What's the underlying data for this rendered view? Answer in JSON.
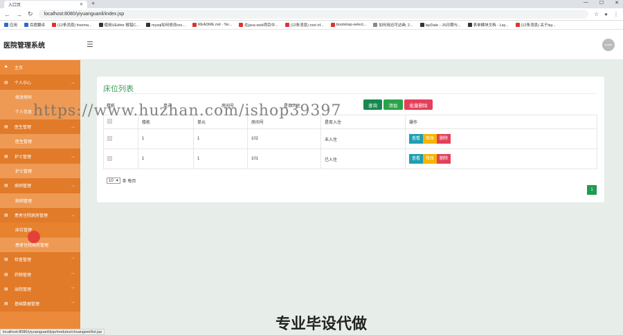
{
  "browser": {
    "tab_title": "入口页",
    "url": "localhost:8080/yiyuanguanli/index.jsp",
    "bookmarks": [
      "应用",
      "百度翻译",
      "(12条消息) freema...",
      "使用UEditor 报错C...",
      "mysql如何修改roo...",
      "README.md - Ter...",
      "在java web项目中...",
      "(12条消息) root of...",
      "bootstrap-select...",
      "如何用迅可达画: 2...",
      "layDate - JS日期与...",
      "表单模块文档 - Lay...",
      "(12条消息) 关于lay..."
    ]
  },
  "app": {
    "title": "医院管理系统",
    "avatar_text": "avatar"
  },
  "sidebar": {
    "items": [
      {
        "label": "主页",
        "type": "top"
      },
      {
        "label": "个人中心",
        "type": "group"
      },
      {
        "label": "修改密码",
        "type": "sub"
      },
      {
        "label": "个人信息",
        "type": "sub"
      },
      {
        "label": "医生管理",
        "type": "group"
      },
      {
        "label": "医生管理",
        "type": "sub"
      },
      {
        "label": "护士管理",
        "type": "group"
      },
      {
        "label": "护士管理",
        "type": "sub"
      },
      {
        "label": "病例管理",
        "type": "group"
      },
      {
        "label": "病例管理",
        "type": "sub"
      },
      {
        "label": "患者住院病房管理",
        "type": "group"
      },
      {
        "label": "床位管理",
        "type": "sub"
      },
      {
        "label": "患者住院病房管理",
        "type": "sub"
      },
      {
        "label": "检查管理",
        "type": "group"
      },
      {
        "label": "药物管理",
        "type": "group"
      },
      {
        "label": "出院管理",
        "type": "group"
      },
      {
        "label": "基础数据管理",
        "type": "group"
      }
    ]
  },
  "main": {
    "card_title": "床位列表",
    "filters": {
      "building": "楼栋",
      "unit": "单元",
      "room": "房间号",
      "checked_in": "是否入住"
    },
    "buttons": {
      "search": "查询",
      "add": "添加",
      "batch_delete": "批量删除"
    },
    "table": {
      "headers": [
        "楼栋",
        "单元",
        "房间号",
        "是否入住",
        "操作"
      ],
      "rows": [
        {
          "building": "1",
          "unit": "1",
          "room": "102",
          "status": "未入住"
        },
        {
          "building": "1",
          "unit": "1",
          "room": "101",
          "status": "已入住"
        }
      ],
      "actions": {
        "view": "查看",
        "edit": "修改",
        "delete": "删除"
      }
    },
    "pager": {
      "page_size": "10",
      "suffix": "条 每页",
      "current_page": "1"
    }
  },
  "overlay": {
    "watermark": "https://www.huzhan.com/ishop39397",
    "promo": "专业毕设代做"
  },
  "status_url": "localhost:8080/yiyuanguanli/jsp/modules/chuangwei/list.jsp"
}
